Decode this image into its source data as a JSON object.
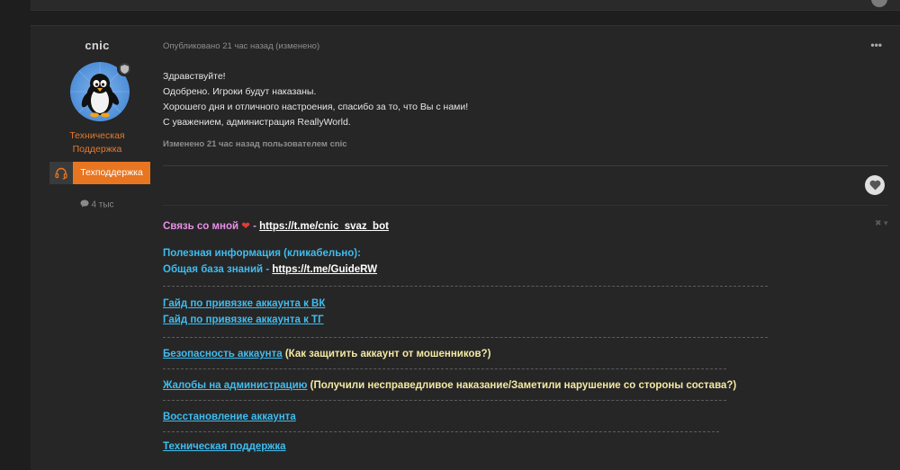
{
  "author": {
    "name": "cnic",
    "role_line1": "Техническая",
    "role_line2": "Поддержка",
    "group_label": "Техподдержка",
    "post_count": "4 тыс"
  },
  "post": {
    "meta": "Опубликовано 21 час назад (изменено)",
    "more": "•••",
    "lines": [
      "Здравствуйте!",
      "Одобрено. Игроки будут наказаны.",
      "Хорошего дня и отличного настроения, спасибо за то, что Вы с нами!",
      "С уважением, администрация ReallyWorld."
    ],
    "edited": "Изменено 21 час назад пользователем cnic"
  },
  "signature": {
    "contact_label": "Связь со мной",
    "heart": "❤",
    "dash": " - ",
    "contact_link": "https://t.me/cnic_svaz_bot",
    "useful_info": "Полезная информация (кликабельно):",
    "kb_label": "Общая база знаний - ",
    "kb_link": "https://t.me/GuideRW",
    "guide_vk": "Гайд по привязке аккаунта к ВК",
    "guide_tg": "Гайд по привязке аккаунта к ТГ",
    "security_link": "Безопасность аккаунта",
    "security_note": " (Как защитить аккаунт от мошенников?)",
    "complaints_link": "Жалобы на администрацию",
    "complaints_note": " (Получили несправедливое наказание/Заметили нарушение со стороны состава?)",
    "recovery_link": "Восстановление аккаунта",
    "support_link": "Техническая поддержка",
    "close": "✖ ▾"
  },
  "colors": {
    "accent_orange": "#e87621",
    "link_cyan": "#3fbdf0",
    "pink": "#e890e8",
    "yellow_note": "#f4e9a4"
  }
}
